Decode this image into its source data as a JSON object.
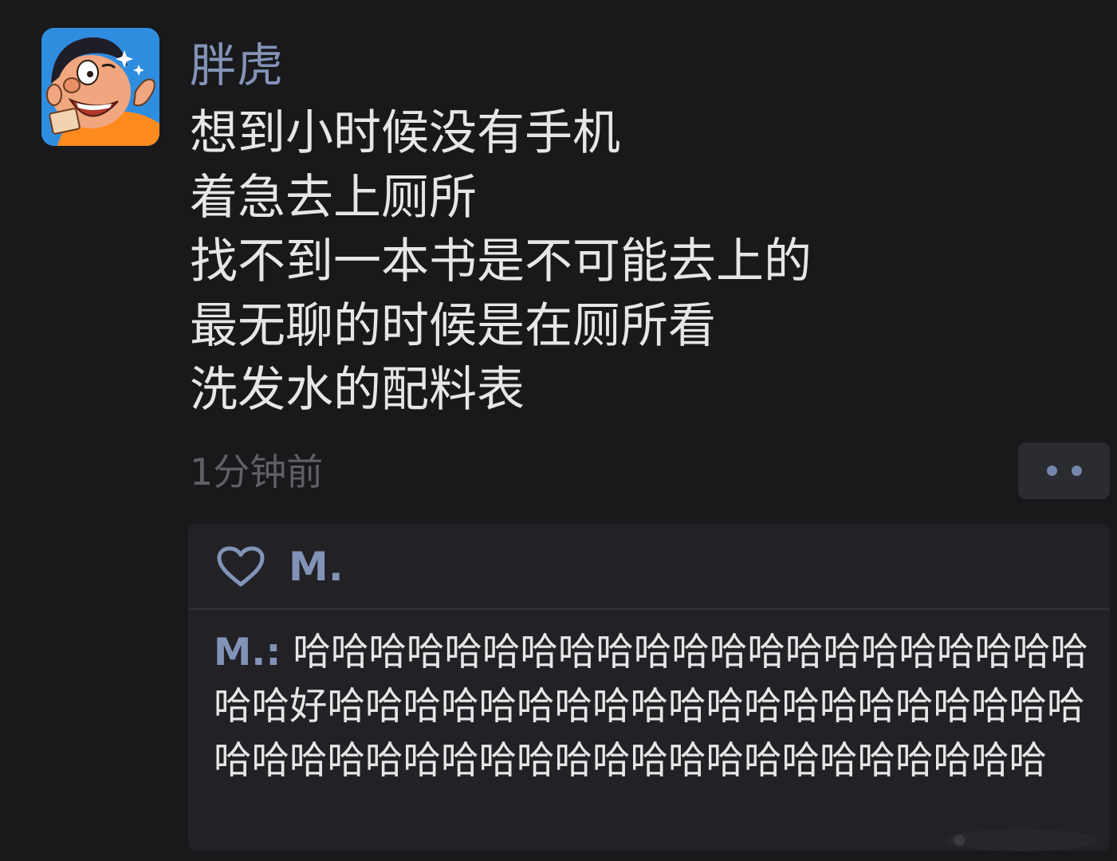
{
  "post": {
    "username": "胖虎",
    "lines": [
      "想到小时候没有手机",
      "着急去上厕所",
      "找不到一本书是不可能去上的",
      "最无聊的时候是在厕所看",
      "洗发水的配料表"
    ],
    "timestamp": "1分钟前",
    "avatar_icon": "cartoon-avatar-icon"
  },
  "actions": {
    "more_icon": "more-dots-icon"
  },
  "comments_panel": {
    "like_icon": "heart-outline-icon",
    "likers": "M.",
    "comment": {
      "author": "M.:",
      "text": "哈哈哈哈哈哈哈哈哈哈哈哈哈哈哈哈哈哈哈哈哈哈哈好哈哈哈哈哈哈哈哈哈哈哈哈哈哈哈哈哈哈哈哈哈哈哈哈哈哈哈哈哈哈哈哈哈哈哈哈哈哈哈哈哈哈"
    }
  },
  "colors": {
    "background": "#19191b",
    "accent": "#8393b8",
    "text": "#e6e6e6",
    "muted": "#5f6064",
    "panel": "#222226"
  }
}
